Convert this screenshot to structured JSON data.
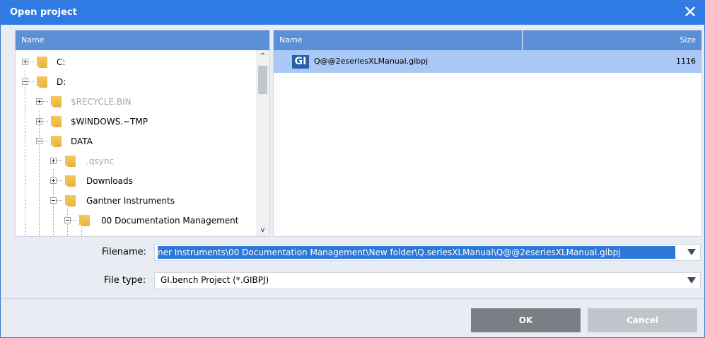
{
  "window": {
    "title": "Open project",
    "close_glyph": "✕"
  },
  "tree": {
    "header": "Name",
    "items": [
      {
        "label": "C:",
        "expander": "plus",
        "dim": false
      },
      {
        "label": "D:",
        "expander": "minus",
        "dim": false
      },
      {
        "label": "$RECYCLE.BIN",
        "expander": "plus",
        "dim": true
      },
      {
        "label": "$WINDOWS.~TMP",
        "expander": "plus",
        "dim": false
      },
      {
        "label": "DATA",
        "expander": "minus",
        "dim": false
      },
      {
        "label": ".qsync",
        "expander": "plus",
        "dim": true
      },
      {
        "label": "Downloads",
        "expander": "plus",
        "dim": false
      },
      {
        "label": "Gantner Instruments",
        "expander": "minus",
        "dim": false
      },
      {
        "label": "00 Documentation Management",
        "expander": "minus",
        "dim": false
      }
    ],
    "scroll_up": "^",
    "scroll_down": "v"
  },
  "files": {
    "header_name": "Name",
    "header_size": "Size",
    "rows": [
      {
        "icon_text": "GI",
        "name": "Q@@2eseriesXLManual.gibpj",
        "size": "1116"
      }
    ]
  },
  "form": {
    "filename_label": "Filename:",
    "filename_value": "ner Instruments\\00 Documentation Management\\New folder\\Q.seriesXLManual\\Q@@2eseriesXLManual.gibpj",
    "filetype_label": "File type:",
    "filetype_value": "GI.bench Project (*.GIBPJ)"
  },
  "buttons": {
    "ok": "OK",
    "cancel": "Cancel"
  },
  "colors": {
    "titlebar": "#2f7be6",
    "header": "#5b8fd6",
    "selection": "#a9c8f5",
    "accent": "#2f78d8"
  }
}
